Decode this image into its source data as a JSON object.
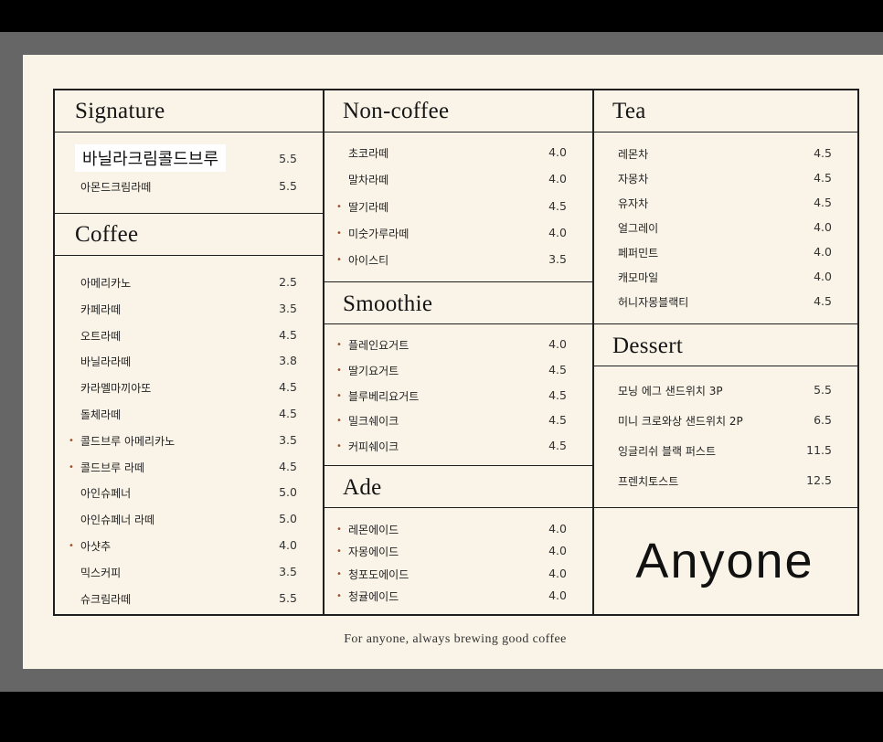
{
  "signature": {
    "title": "Signature",
    "items": [
      {
        "name": "바닐라크림콜드브루",
        "price": "5.5",
        "highlight": true
      },
      {
        "name": "아몬드크림라떼",
        "price": "5.5"
      }
    ]
  },
  "coffee": {
    "title": "Coffee",
    "items": [
      {
        "name": "아메리카노",
        "price": "2.5"
      },
      {
        "name": "카페라떼",
        "price": "3.5"
      },
      {
        "name": "오트라떼",
        "price": "4.5"
      },
      {
        "name": "바닐라라떼",
        "price": "3.8"
      },
      {
        "name": "카라멜마끼아또",
        "price": "4.5"
      },
      {
        "name": "돌체라떼",
        "price": "4.5"
      },
      {
        "name": "콜드브루 아메리카노",
        "price": "3.5",
        "dot": true
      },
      {
        "name": "콜드브루 라떼",
        "price": "4.5",
        "dot": true
      },
      {
        "name": "아인슈페너",
        "price": "5.0"
      },
      {
        "name": "아인슈페너 라떼",
        "price": "5.0"
      },
      {
        "name": "아샷추",
        "price": "4.0",
        "dot": true
      },
      {
        "name": "믹스커피",
        "price": "3.5"
      },
      {
        "name": "슈크림라떼",
        "price": "5.5"
      }
    ]
  },
  "noncoffee": {
    "title": "Non-coffee",
    "items": [
      {
        "name": "초코라떼",
        "price": "4.0"
      },
      {
        "name": "말차라떼",
        "price": "4.0"
      },
      {
        "name": "딸기라떼",
        "price": "4.5",
        "dot": true
      },
      {
        "name": "미숫가루라떼",
        "price": "4.0",
        "dot": true
      },
      {
        "name": "아이스티",
        "price": "3.5",
        "dot": true
      }
    ]
  },
  "smoothie": {
    "title": "Smoothie",
    "items": [
      {
        "name": "플레인요거트",
        "price": "4.0",
        "dot": true
      },
      {
        "name": "딸기요거트",
        "price": "4.5",
        "dot": true
      },
      {
        "name": "블루베리요거트",
        "price": "4.5",
        "dot": true
      },
      {
        "name": "밀크쉐이크",
        "price": "4.5",
        "dot": true
      },
      {
        "name": "커피쉐이크",
        "price": "4.5",
        "dot": true
      }
    ]
  },
  "ade": {
    "title": "Ade",
    "items": [
      {
        "name": "레몬에이드",
        "price": "4.0",
        "dot": true
      },
      {
        "name": "자몽에이드",
        "price": "4.0",
        "dot": true
      },
      {
        "name": "청포도에이드",
        "price": "4.0",
        "dot": true
      },
      {
        "name": "청귤에이드",
        "price": "4.0",
        "dot": true
      }
    ]
  },
  "tea": {
    "title": "Tea",
    "items": [
      {
        "name": "레몬차",
        "price": "4.5"
      },
      {
        "name": "자몽차",
        "price": "4.5"
      },
      {
        "name": "유자차",
        "price": "4.5"
      },
      {
        "name": "얼그레이",
        "price": "4.0"
      },
      {
        "name": "페퍼민트",
        "price": "4.0"
      },
      {
        "name": "캐모마일",
        "price": "4.0"
      },
      {
        "name": "허니자몽블랙티",
        "price": "4.5"
      }
    ]
  },
  "dessert": {
    "title": "Dessert",
    "items": [
      {
        "name": "모닝 에그 샌드위치 3P",
        "price": "5.5"
      },
      {
        "name": "미니 크로와상 샌드위치 2P",
        "price": "6.5"
      },
      {
        "name": "잉글리쉬 블랙 퍼스트",
        "price": "11.5"
      },
      {
        "name": "프렌치토스트",
        "price": "12.5"
      }
    ]
  },
  "brand": "Anyone",
  "tagline": "For anyone, always brewing good coffee",
  "colors": {
    "paper": "#faf4e8",
    "line": "#1e1e1e",
    "dot": "#a0522d"
  }
}
